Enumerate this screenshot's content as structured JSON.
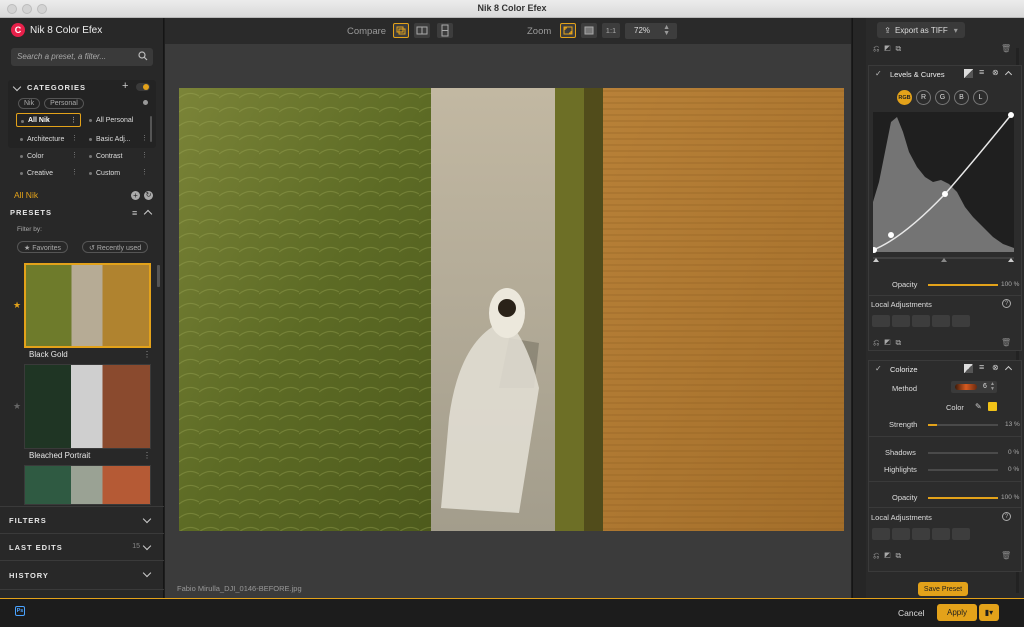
{
  "window": {
    "title": "Nik 8 Color Efex"
  },
  "brand": {
    "name": "Nik 8 Color Efex",
    "logo_letter": "C"
  },
  "search": {
    "placeholder": "Search a preset, a filter..."
  },
  "categories": {
    "title": "CATEGORIES",
    "chips": [
      "Nik",
      "Personal"
    ],
    "items": [
      "All Nik",
      "All Personal",
      "Architecture",
      "Basic Adj...",
      "Color",
      "Contrast",
      "Creative",
      "Custom"
    ],
    "selected": "All Nik"
  },
  "current_collection": "All Nik",
  "presets": {
    "title": "PRESETS",
    "filter_by": "Filter by:",
    "filters": [
      "Favorites",
      "Recently used"
    ],
    "items": [
      {
        "name": "Black Gold",
        "favorite": true,
        "selected": true
      },
      {
        "name": "Bleached Portrait",
        "favorite": false,
        "selected": false
      }
    ]
  },
  "left_sections": [
    {
      "title": "FILTERS",
      "count": ""
    },
    {
      "title": "LAST EDITS",
      "count": "15"
    },
    {
      "title": "HISTORY",
      "count": ""
    }
  ],
  "toolbar": {
    "compare_label": "Compare",
    "zoom_label": "Zoom",
    "zoom_ratio": "1:1",
    "zoom_value": "72%"
  },
  "image": {
    "filename": "Fabio Mirulla_DJI_0146-BEFORE.jpg"
  },
  "export": {
    "label": "Export as TIFF"
  },
  "levels_curves": {
    "title": "Levels & Curves",
    "channels": [
      "RGB",
      "R",
      "G",
      "B",
      "L"
    ],
    "active_channel": "RGB",
    "opacity_label": "Opacity",
    "opacity_value": "100 %",
    "opacity": 1.0,
    "local_adjustments": "Local Adjustments"
  },
  "colorize": {
    "title": "Colorize",
    "method_label": "Method",
    "method_value": "6",
    "color_label": "Color",
    "color_swatch": "#f2c318",
    "strength_label": "Strength",
    "strength_value": "13 %",
    "strength": 0.13,
    "shadows_label": "Shadows",
    "shadows_value": "0 %",
    "highlights_label": "Highlights",
    "highlights_value": "0 %",
    "opacity_label": "Opacity",
    "opacity_value": "100 %",
    "opacity": 1.0,
    "local_adjustments": "Local Adjustments"
  },
  "save_preset": "Save Preset",
  "bottom": {
    "cancel": "Cancel",
    "apply": "Apply",
    "ps_badge": "Ps"
  },
  "colors": {
    "accent": "#e3a21a",
    "brand": "#e8204a"
  }
}
